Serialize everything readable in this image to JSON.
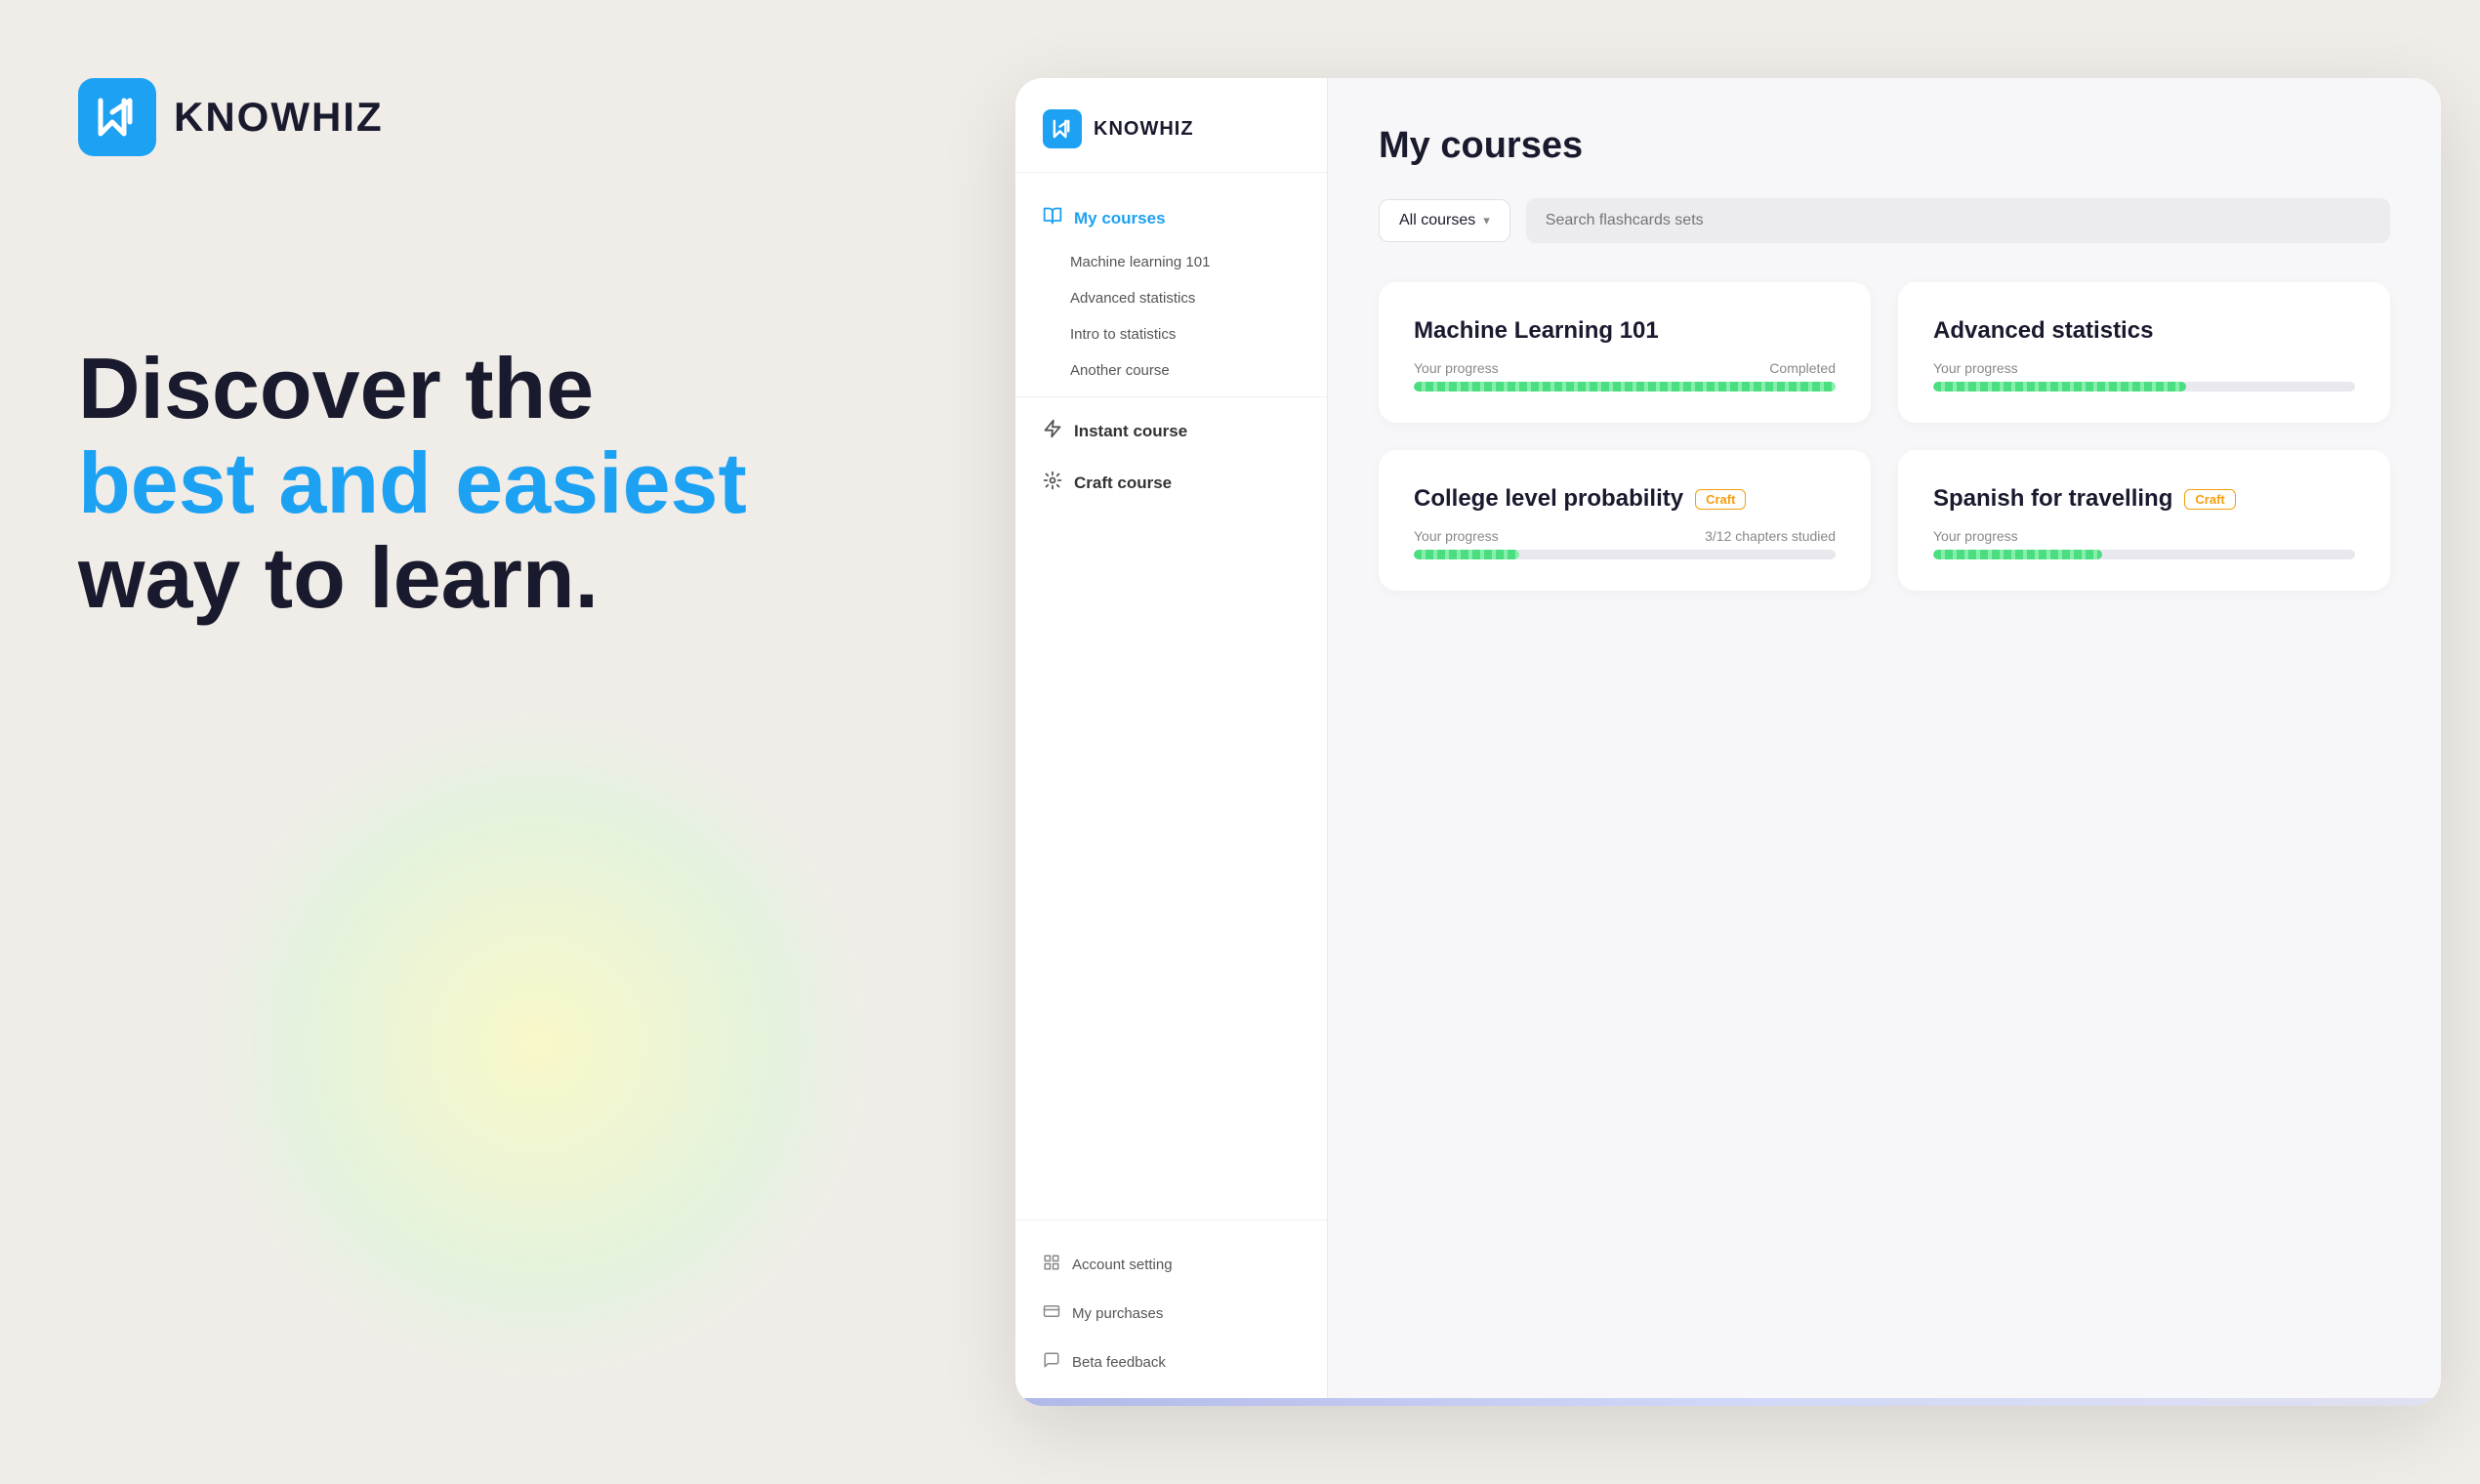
{
  "brand": {
    "name": "KNOWHIZ",
    "logo_alt": "K logo"
  },
  "hero": {
    "line1": "Discover the",
    "line2": "best and easiest",
    "line3": "way to learn."
  },
  "sidebar": {
    "logo_text": "KNOWHIZ",
    "nav": {
      "my_courses_label": "My courses",
      "sub_items": [
        {
          "label": "Machine learning 101"
        },
        {
          "label": "Advanced statistics"
        },
        {
          "label": "Intro to statistics"
        },
        {
          "label": "Another course"
        }
      ],
      "instant_course_label": "Instant course",
      "craft_course_label": "Craft course"
    },
    "footer": {
      "account_setting": "Account setting",
      "my_purchases": "My purchases",
      "beta_feedback": "Beta feedback"
    }
  },
  "main": {
    "title": "My courses",
    "filter": {
      "dropdown_label": "All courses",
      "search_placeholder": "Search flashcards sets"
    },
    "courses": [
      {
        "id": "ml101",
        "title": "Machine Learning 101",
        "badge": null,
        "progress_label": "Your progress",
        "progress_status": "Completed",
        "progress_pct": 100
      },
      {
        "id": "adv_stats",
        "title": "Advanced statistics",
        "badge": null,
        "progress_label": "Your progress",
        "progress_status": "",
        "progress_pct": 60
      },
      {
        "id": "college_prob",
        "title": "College level probability",
        "badge": "Craft",
        "progress_label": "Your progress",
        "progress_status": "3/12 chapters studied",
        "progress_pct": 25
      },
      {
        "id": "spanish",
        "title": "Spanish for travelling",
        "badge": "Craft",
        "progress_label": "Your progress",
        "progress_status": "",
        "progress_pct": 40
      }
    ]
  }
}
